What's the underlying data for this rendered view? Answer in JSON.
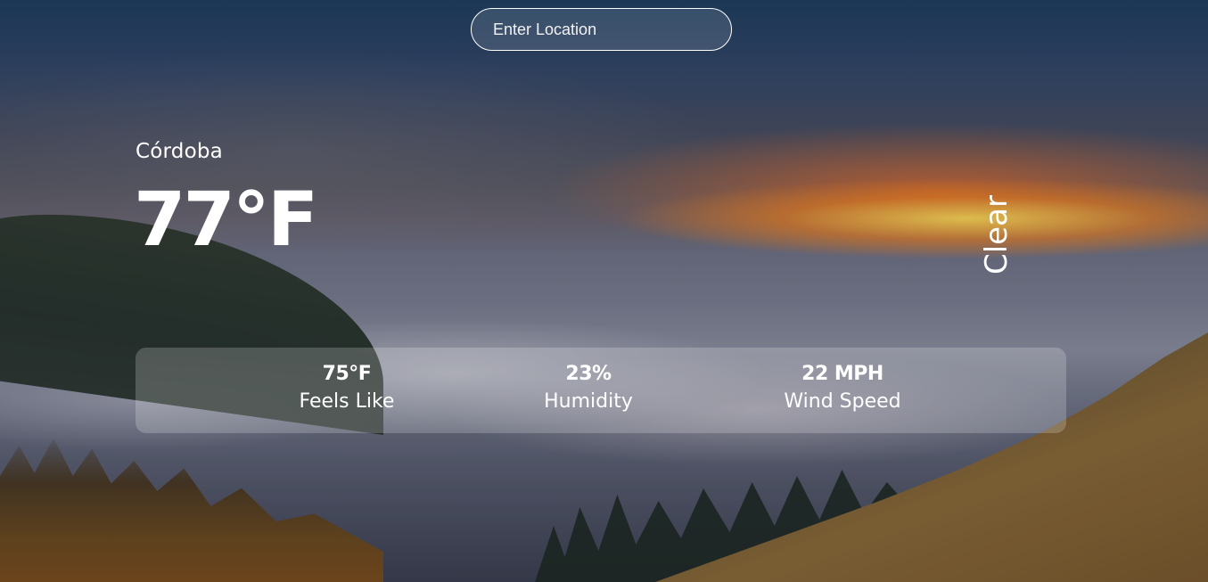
{
  "search": {
    "placeholder": "Enter Location",
    "value": ""
  },
  "weather": {
    "location": "Córdoba",
    "temperature": "77°F",
    "condition": "Clear"
  },
  "stats": {
    "feels_like": {
      "value": "75°F",
      "label": "Feels Like"
    },
    "humidity": {
      "value": "23%",
      "label": "Humidity"
    },
    "wind_speed": {
      "value": "22 MPH",
      "label": "Wind Speed"
    }
  },
  "background": {
    "description": "sunset-over-fog-landscape",
    "accent_sun": "#ffb23a",
    "sky_top": "#1f3f62"
  }
}
